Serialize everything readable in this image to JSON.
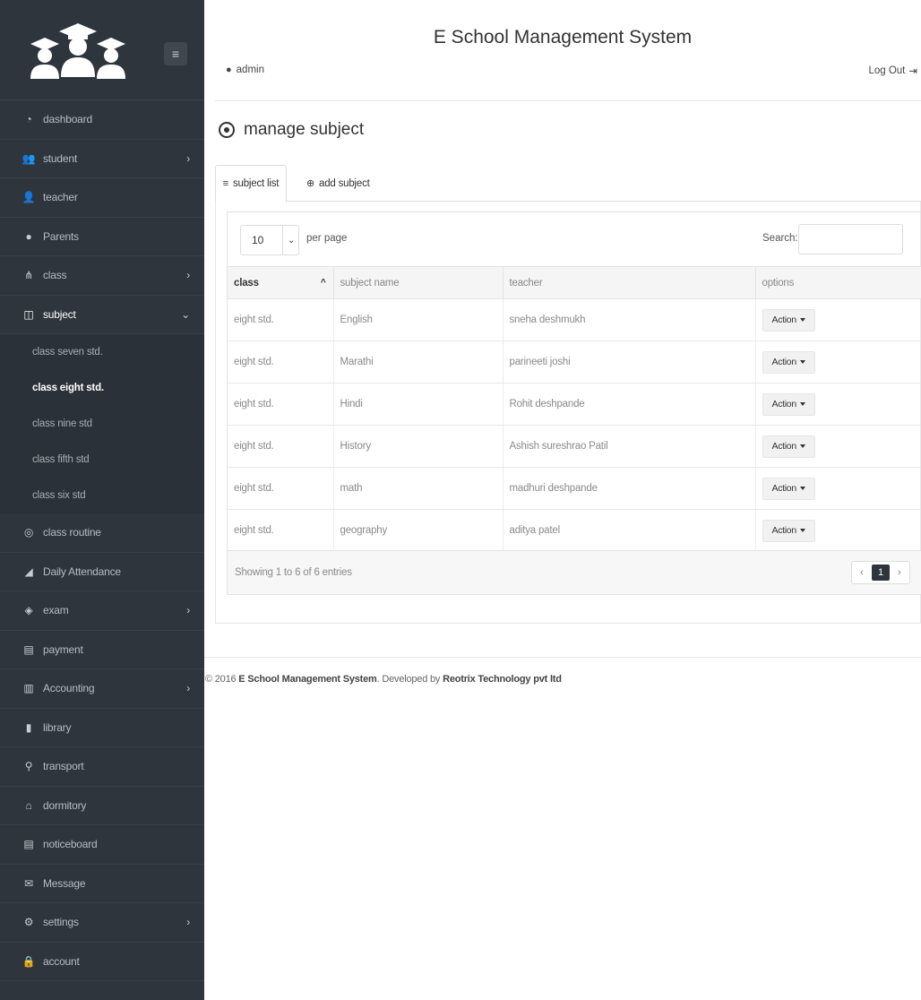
{
  "app": {
    "title": "E School Management System",
    "user": "admin",
    "logout": "Log Out"
  },
  "sidebar": {
    "items": [
      {
        "label": "dashboard",
        "icon": "dashboard-icon"
      },
      {
        "label": "student",
        "icon": "users-icon",
        "has_children": true
      },
      {
        "label": "teacher",
        "icon": "teacher-icon"
      },
      {
        "label": "Parents",
        "icon": "user-icon"
      },
      {
        "label": "class",
        "icon": "sitemap-icon",
        "has_children": true
      },
      {
        "label": "subject",
        "icon": "book-icon",
        "has_children": true,
        "expanded": true
      }
    ],
    "subject_children": [
      {
        "label": "class seven std."
      },
      {
        "label": "class eight std.",
        "active": true
      },
      {
        "label": "class nine std"
      },
      {
        "label": "class fifth std"
      },
      {
        "label": "class six std"
      }
    ],
    "items_after": [
      {
        "label": "class routine",
        "icon": "target-icon"
      },
      {
        "label": "Daily Attendance",
        "icon": "chart-icon"
      },
      {
        "label": "exam",
        "icon": "graduation-icon",
        "has_children": true
      },
      {
        "label": "payment",
        "icon": "card-icon"
      },
      {
        "label": "Accounting",
        "icon": "briefcase-icon",
        "has_children": true
      },
      {
        "label": "library",
        "icon": "book-icon"
      },
      {
        "label": "transport",
        "icon": "location-icon"
      },
      {
        "label": "dormitory",
        "icon": "home-icon"
      },
      {
        "label": "noticeboard",
        "icon": "notice-icon"
      },
      {
        "label": "Message",
        "icon": "envelope-icon"
      },
      {
        "label": "settings",
        "icon": "settings-icon",
        "has_children": true
      },
      {
        "label": "account",
        "icon": "lock-icon"
      }
    ]
  },
  "page": {
    "title": "manage subject"
  },
  "tabs": [
    {
      "label": "subject list",
      "active": true
    },
    {
      "label": "add subject"
    }
  ],
  "table": {
    "page_length": "10",
    "per_page_label": "per page",
    "search_label": "Search:",
    "columns": [
      "class",
      "subject name",
      "teacher",
      "options"
    ],
    "rows": [
      [
        "eight std.",
        "English",
        "sneha deshmukh",
        "Action"
      ],
      [
        "eight std.",
        "Marathi",
        "parineeti joshi",
        "Action"
      ],
      [
        "eight std.",
        "Hindi",
        "Rohit deshpande",
        "Action"
      ],
      [
        "eight std.",
        "History",
        "Ashish sureshrao Patil",
        "Action"
      ],
      [
        "eight std.",
        "math",
        "madhuri deshpande",
        "Action"
      ],
      [
        "eight std.",
        "geography",
        "aditya patel",
        "Action"
      ]
    ],
    "info": "Showing 1 to 6 of 6 entries",
    "pagination": {
      "prev": "‹",
      "current": "1",
      "next": "›"
    }
  },
  "footer": {
    "prefix": "© 2016 ",
    "brand": "E School Management System",
    "middle": ". Developed by ",
    "company": "Reotrix Technology pvt ltd"
  }
}
